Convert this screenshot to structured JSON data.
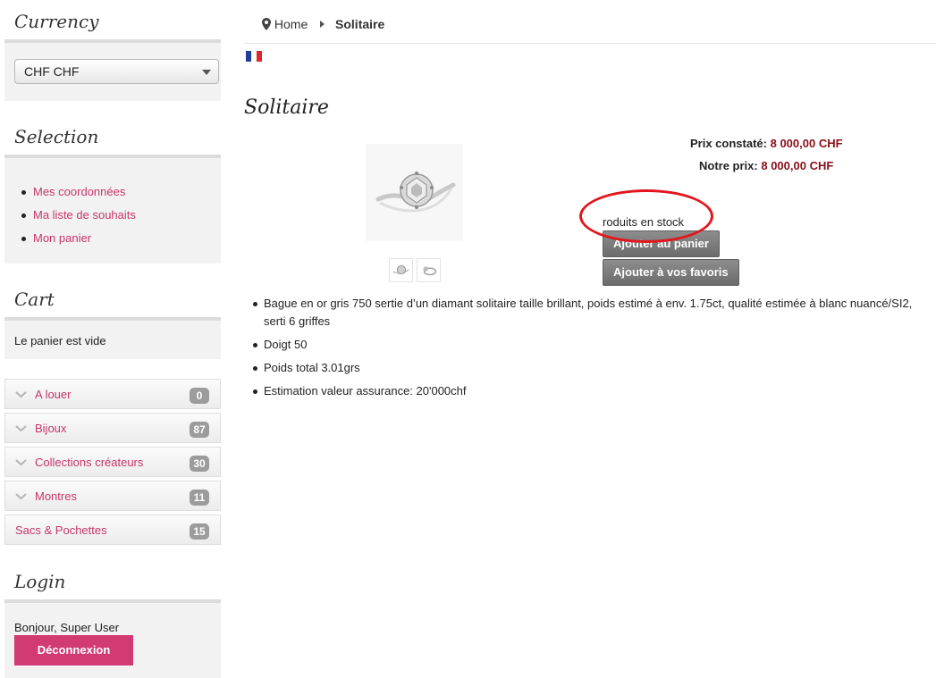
{
  "sidebar": {
    "currency": {
      "title": "Currency",
      "selected": "CHF CHF"
    },
    "selection": {
      "title": "Selection",
      "items": [
        "Mes coordonnées",
        "Ma liste de souhaits",
        "Mon panier"
      ]
    },
    "cart": {
      "title": "Cart",
      "text": "Le panier est vide"
    },
    "categories": [
      {
        "label": "A louer",
        "count": "0"
      },
      {
        "label": "Bijoux",
        "count": "87"
      },
      {
        "label": "Collections créateurs",
        "count": "30"
      },
      {
        "label": "Montres",
        "count": "11"
      },
      {
        "label": "Sacs & Pochettes",
        "count": "15"
      }
    ],
    "login": {
      "title": "Login",
      "greeting": "Bonjour, Super User",
      "logout_label": "Déconnexion"
    }
  },
  "breadcrumb": {
    "home": "Home",
    "current": "Solitaire"
  },
  "flag": {
    "icon": "french-flag-icon",
    "colors": [
      "#1f3f99",
      "#ffffff",
      "#e0252b"
    ]
  },
  "product": {
    "title": "Solitaire",
    "price_list_label": "Prix constaté:",
    "price_list_value": "8 000,00 CHF",
    "price_our_label": "Notre prix:",
    "price_our_value": "8 000,00 CHF",
    "stock_text": "roduits en stock",
    "add_to_cart_label": "Ajouter au panier",
    "add_to_favorites_label": "Ajouter à vos favoris",
    "description": [
      "Bague en or gris 750 sertie d’un diamant solitaire taille brillant, poids estimé à env. 1.75ct, qualité estimée à blanc nuancé/SI2, serti 6 griffes",
      "Doigt 50",
      "Poids total 3.01grs",
      "Estimation valeur assurance: 20'000chf"
    ]
  },
  "colors": {
    "accent": "#c8346b",
    "price": "#8a0d17",
    "button": "#d23a74",
    "annotation": "#e3161d"
  }
}
